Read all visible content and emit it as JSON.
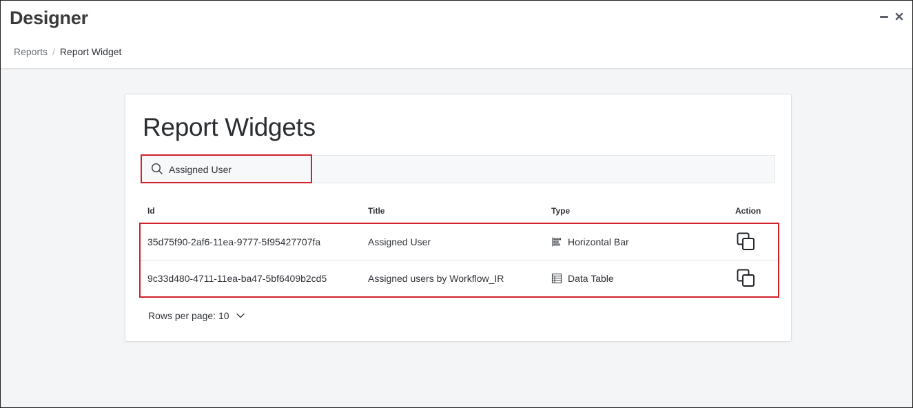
{
  "window": {
    "title": "Designer",
    "minimize_icon": "minimize-icon",
    "close_icon": "close-icon"
  },
  "breadcrumb": {
    "items": [
      {
        "label": "Reports"
      },
      {
        "label": "Report Widget"
      }
    ],
    "separator": "/"
  },
  "page": {
    "title": "Report Widgets"
  },
  "search": {
    "value": "Assigned User",
    "placeholder": "",
    "icon": "search-icon"
  },
  "table": {
    "columns": [
      "Id",
      "Title",
      "Type",
      "Action"
    ],
    "rows": [
      {
        "id": "35d75f90-2af6-11ea-9777-5f95427707fa",
        "title": "Assigned User",
        "type": "Horizontal Bar",
        "type_icon": "horizontal-bar-chart-icon",
        "action_icon": "copy-icon"
      },
      {
        "id": "9c33d480-4711-11ea-ba47-5bf6409b2cd5",
        "title": "Assigned users by Workflow_IR",
        "type": "Data Table",
        "type_icon": "data-table-icon",
        "action_icon": "copy-icon"
      }
    ]
  },
  "pagination": {
    "label": "Rows per page: 10",
    "icon": "chevron-down-icon"
  },
  "colors": {
    "highlight": "#d0202a",
    "background": "#f4f5f7",
    "card": "#ffffff"
  }
}
